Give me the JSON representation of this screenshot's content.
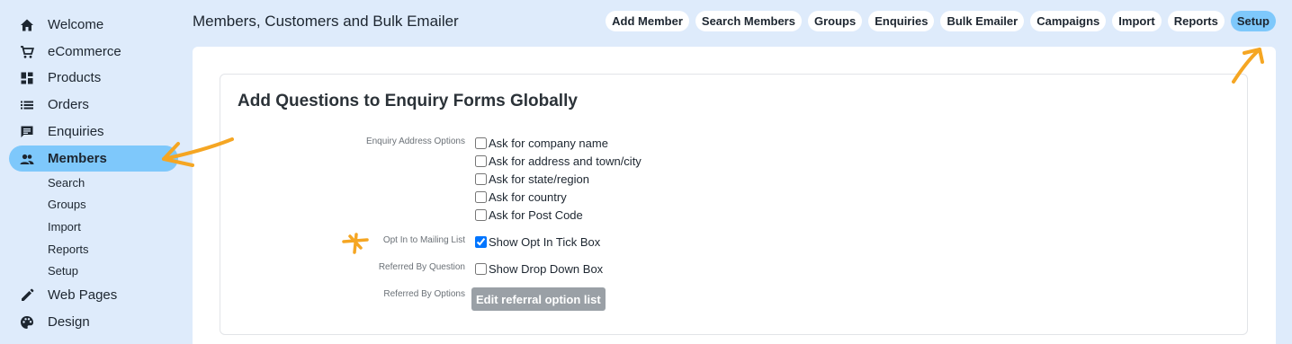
{
  "sidebar": {
    "items": [
      {
        "label": "Welcome",
        "icon": "home-icon"
      },
      {
        "label": "eCommerce",
        "icon": "cart-icon"
      },
      {
        "label": "Products",
        "icon": "dashboard-icon"
      },
      {
        "label": "Orders",
        "icon": "list-icon"
      },
      {
        "label": "Enquiries",
        "icon": "chat-icon"
      },
      {
        "label": "Members",
        "icon": "people-icon",
        "active": true
      },
      {
        "label": "Web Pages",
        "icon": "pencil-icon"
      },
      {
        "label": "Design",
        "icon": "palette-icon"
      }
    ],
    "subitems": [
      "Search",
      "Groups",
      "Import",
      "Reports",
      "Setup"
    ]
  },
  "header": {
    "title": "Members, Customers and Bulk Emailer",
    "tabs": [
      "Add Member",
      "Search Members",
      "Groups",
      "Enquiries",
      "Bulk Emailer",
      "Campaigns",
      "Import",
      "Reports",
      "Setup"
    ],
    "active_tab": "Setup"
  },
  "card": {
    "title": "Add Questions to Enquiry Forms Globally",
    "address_label": "Enquiry Address Options",
    "address_options": [
      {
        "label": "Ask for company name",
        "checked": false
      },
      {
        "label": "Ask for address and town/city",
        "checked": false
      },
      {
        "label": "Ask for state/region",
        "checked": false
      },
      {
        "label": "Ask for country",
        "checked": false
      },
      {
        "label": "Ask for Post Code",
        "checked": false
      }
    ],
    "opt_in_label": "Opt In to Mailing List",
    "opt_in_option": {
      "label": "Show Opt In Tick Box",
      "checked": true
    },
    "referred_label": "Referred By Question",
    "referred_option": {
      "label": "Show Drop Down Box",
      "checked": false
    },
    "referred_options_label": "Referred By Options",
    "edit_button": "Edit referral option list"
  },
  "colors": {
    "background": "#deebfb",
    "accent": "#7ec8fb",
    "annotation": "#f5a623",
    "button_disabled": "#9aa0a6"
  }
}
